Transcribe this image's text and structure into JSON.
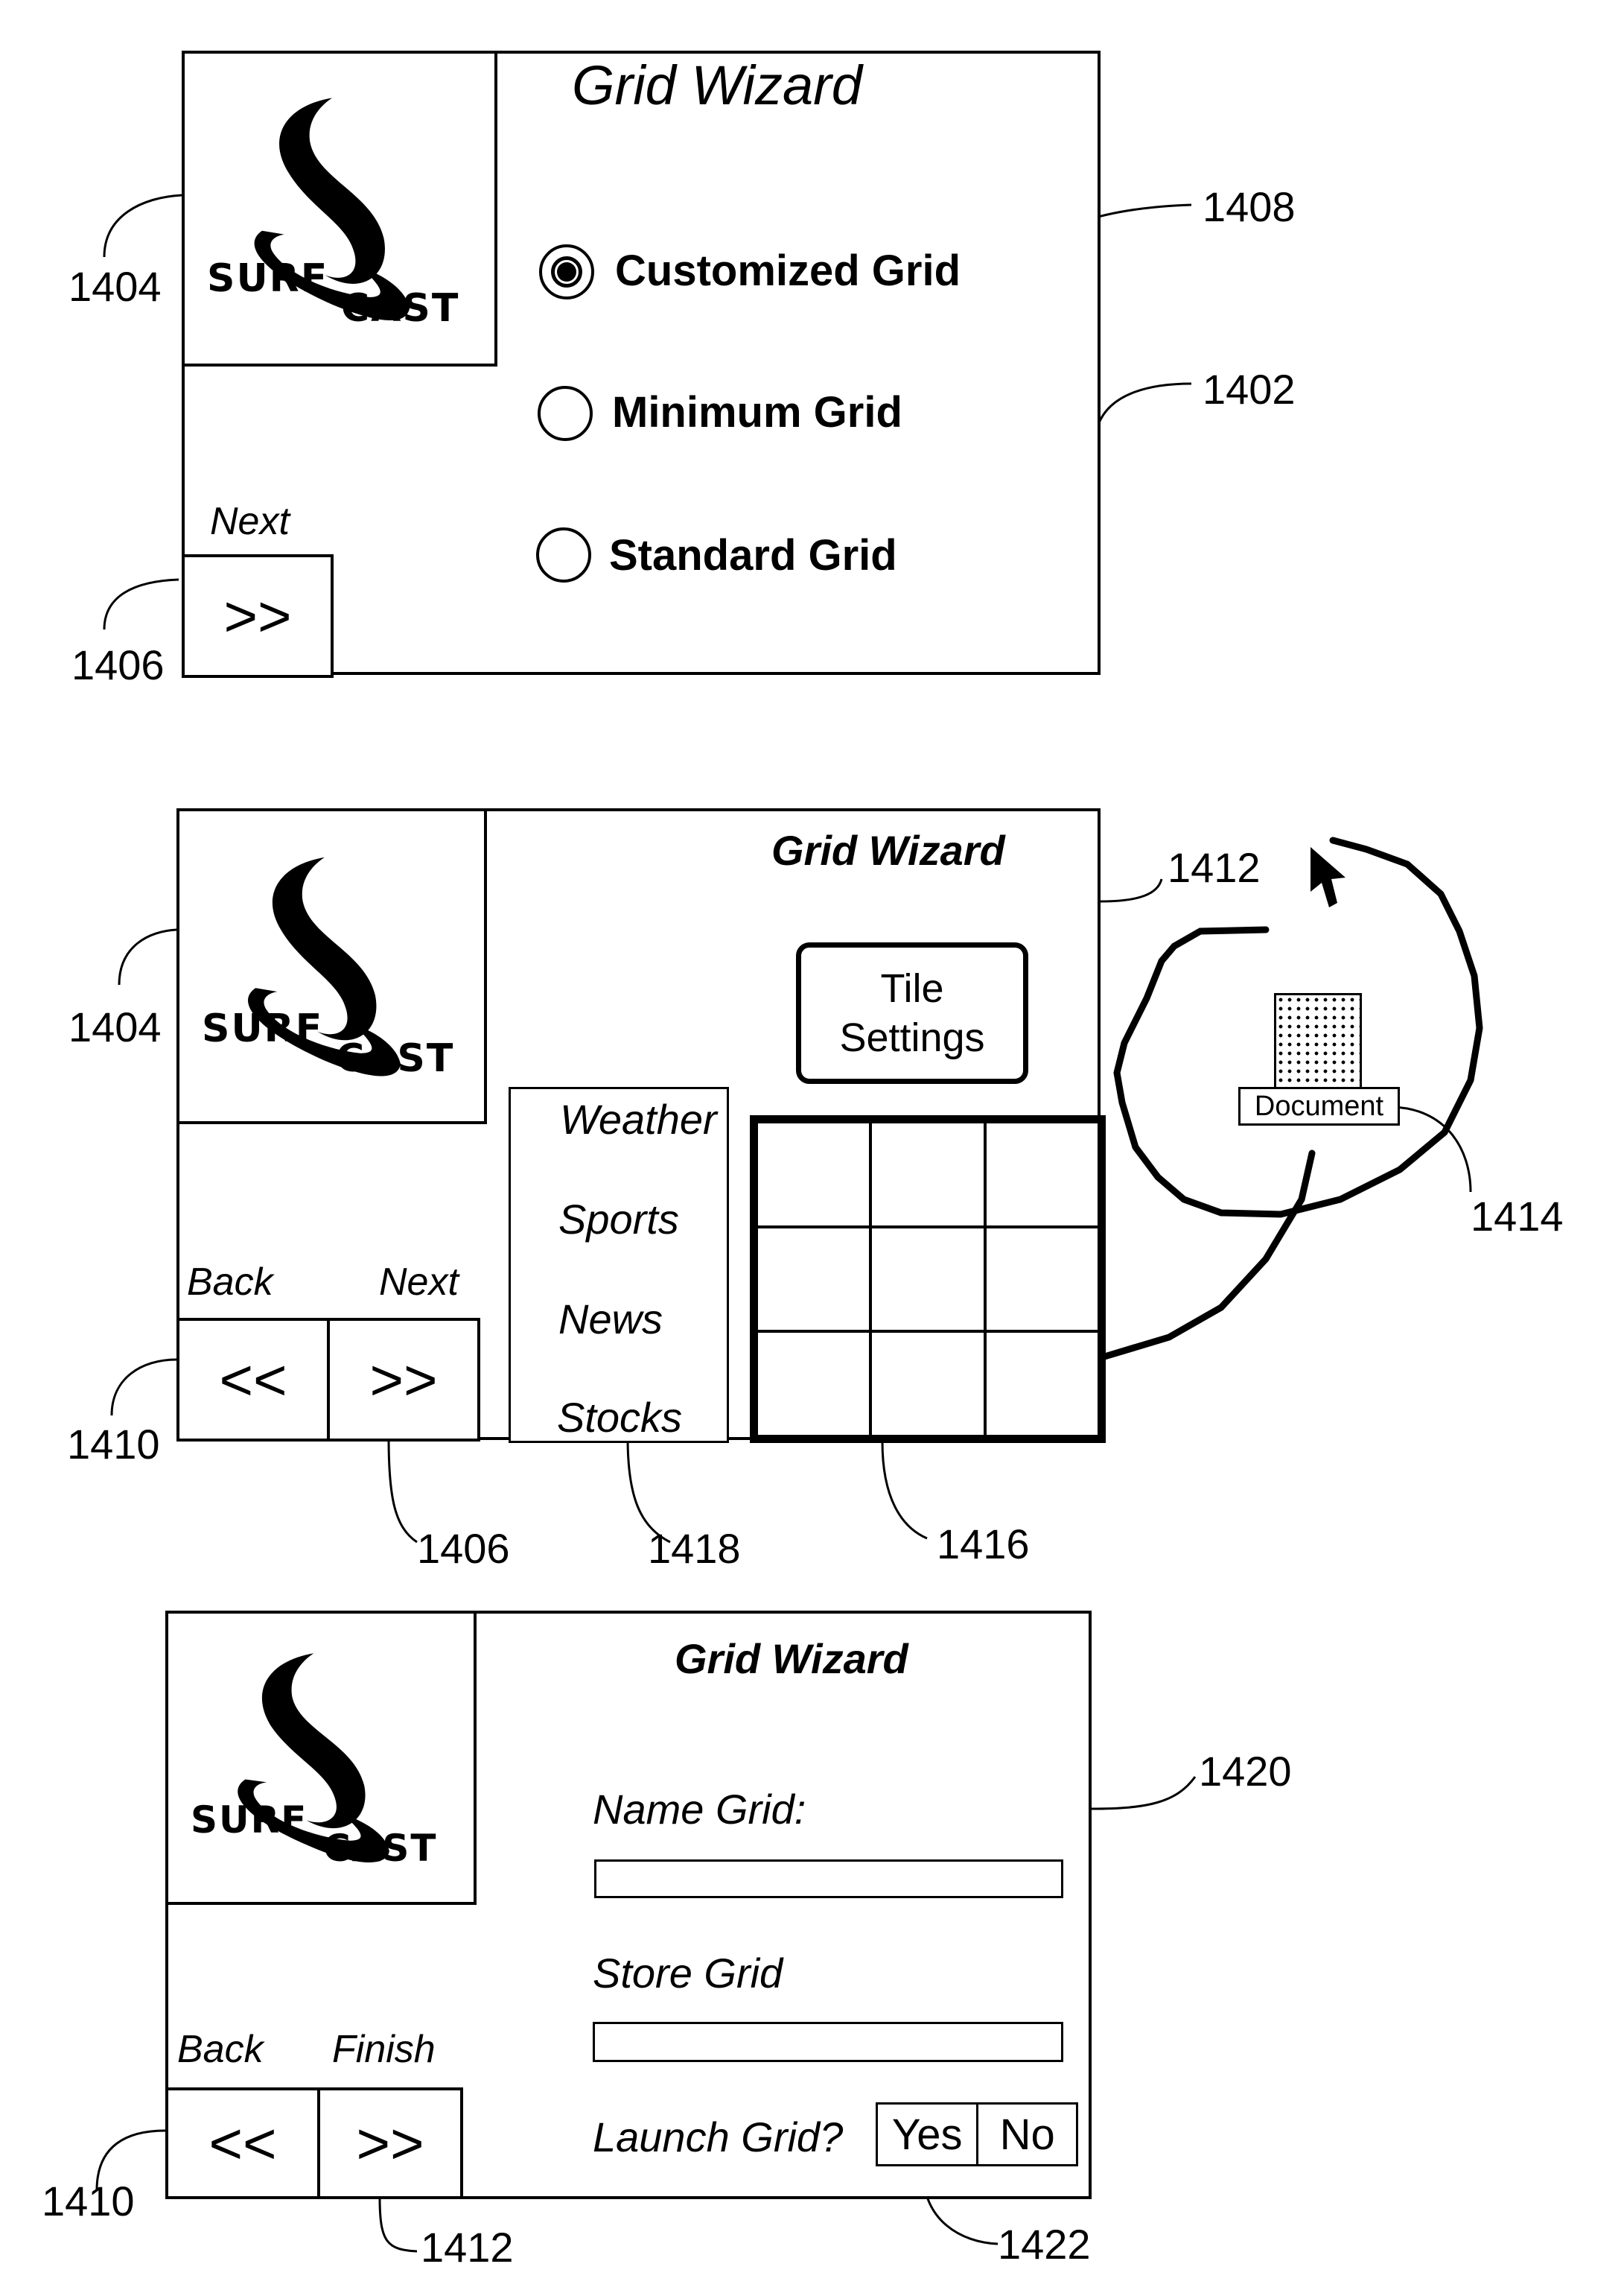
{
  "figure": {
    "panels": [
      {
        "ref": "1402",
        "title": "Grid Wizard",
        "logo": {
          "ref": "1404",
          "word1": "SURF",
          "word2": "CAST"
        },
        "radio_options": [
          {
            "label": "Customized Grid",
            "selected": true,
            "ref": "1408"
          },
          {
            "label": "Minimum Grid",
            "selected": false
          },
          {
            "label": "Standard Grid",
            "selected": false
          }
        ],
        "next": {
          "label": "Next",
          "glyph": ">>",
          "ref": "1406"
        }
      },
      {
        "ref": "1412",
        "title": "Grid Wizard",
        "logo": {
          "ref": "1404",
          "word1": "SURF",
          "word2": "CAST"
        },
        "tile_settings": {
          "line1": "Tile",
          "line2": "Settings"
        },
        "list": {
          "ref": "1418",
          "items": [
            "Weather",
            "Sports",
            "News",
            "Stocks"
          ]
        },
        "grid": {
          "ref": "1416",
          "rows": 3,
          "cols": 3
        },
        "document": {
          "label": "Document",
          "ref": "1414"
        },
        "back": {
          "label": "Back",
          "glyph": "<<",
          "ref": "1410"
        },
        "next": {
          "label": "Next",
          "glyph": ">>",
          "ref": "1406"
        }
      },
      {
        "ref": "1420",
        "title": "Grid Wizard",
        "logo": {
          "word1": "SURF",
          "word2": "CAST"
        },
        "name_grid": {
          "label": "Name Grid:",
          "value": ""
        },
        "store_grid": {
          "label": "Store Grid",
          "value": ""
        },
        "launch": {
          "label": "Launch Grid?",
          "yes": "Yes",
          "no": "No",
          "ref": "1422"
        },
        "back": {
          "label": "Back",
          "glyph": "<<",
          "ref": "1410"
        },
        "finish": {
          "label": "Finish",
          "glyph": ">>",
          "ref": "1412"
        }
      }
    ]
  }
}
